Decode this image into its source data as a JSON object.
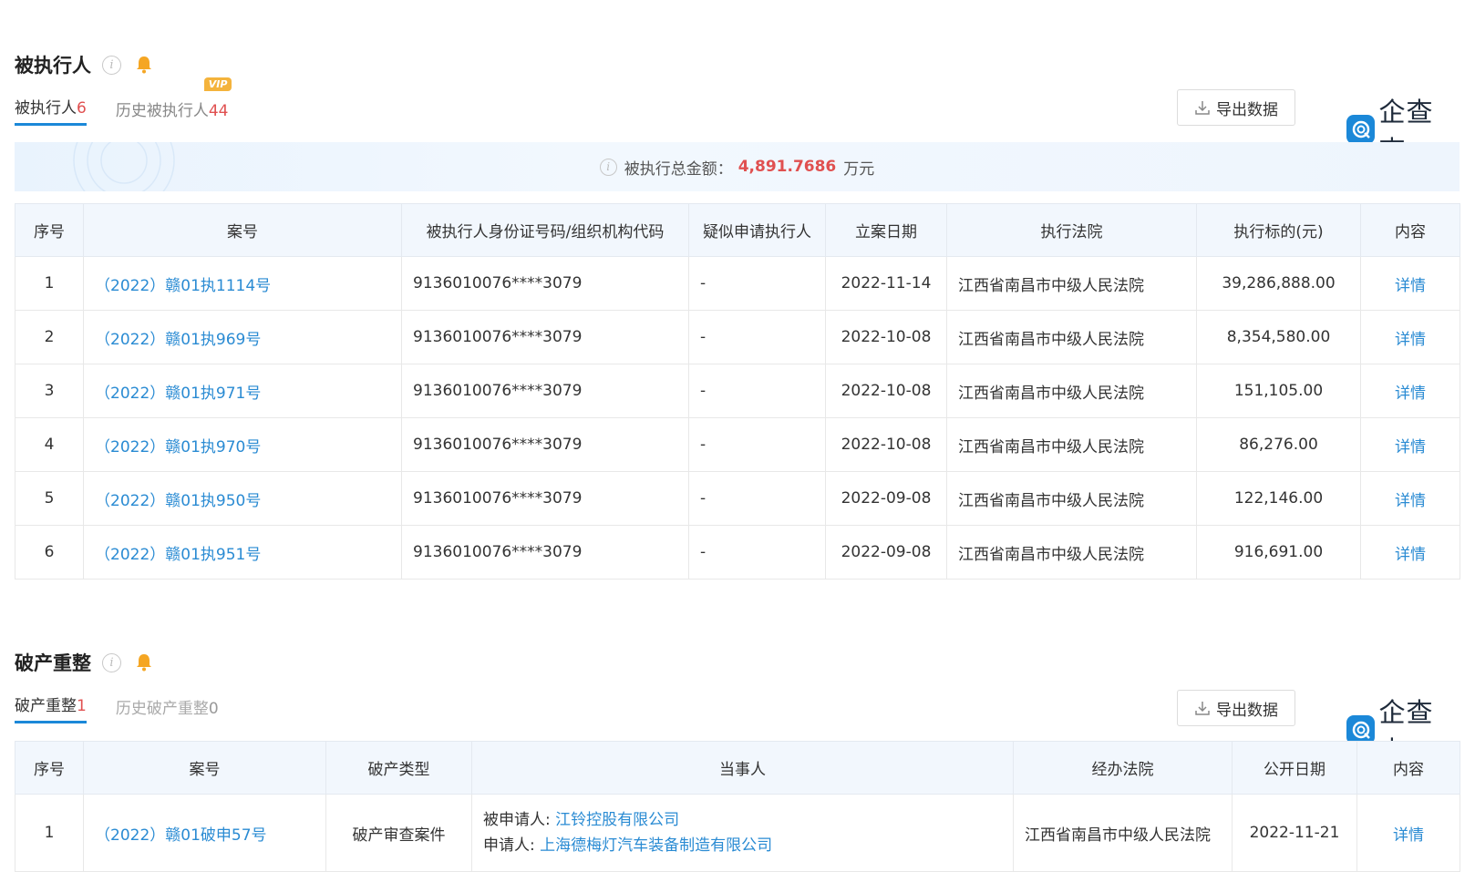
{
  "section1": {
    "title": "被执行人",
    "tabs": [
      {
        "label": "被执行人",
        "count": "6"
      },
      {
        "label": "历史被执行人",
        "count": "44",
        "badge": "VIP"
      }
    ],
    "export_label": "导出数据",
    "brand": "企查查",
    "summary": {
      "label": "被执行总金额：",
      "amount": "4,891.7686",
      "unit": "万元"
    },
    "headers": [
      "序号",
      "案号",
      "被执行人身份证号码/组织机构代码",
      "疑似申请执行人",
      "立案日期",
      "执行法院",
      "执行标的(元)",
      "内容"
    ],
    "rows": [
      {
        "no": "1",
        "case": "（2022）赣01执1114号",
        "id": "9136010076****3079",
        "applicant": "-",
        "date": "2022-11-14",
        "court": "江西省南昌市中级人民法院",
        "amount": "39,286,888.00",
        "action": "详情"
      },
      {
        "no": "2",
        "case": "（2022）赣01执969号",
        "id": "9136010076****3079",
        "applicant": "-",
        "date": "2022-10-08",
        "court": "江西省南昌市中级人民法院",
        "amount": "8,354,580.00",
        "action": "详情"
      },
      {
        "no": "3",
        "case": "（2022）赣01执971号",
        "id": "9136010076****3079",
        "applicant": "-",
        "date": "2022-10-08",
        "court": "江西省南昌市中级人民法院",
        "amount": "151,105.00",
        "action": "详情"
      },
      {
        "no": "4",
        "case": "（2022）赣01执970号",
        "id": "9136010076****3079",
        "applicant": "-",
        "date": "2022-10-08",
        "court": "江西省南昌市中级人民法院",
        "amount": "86,276.00",
        "action": "详情"
      },
      {
        "no": "5",
        "case": "（2022）赣01执950号",
        "id": "9136010076****3079",
        "applicant": "-",
        "date": "2022-09-08",
        "court": "江西省南昌市中级人民法院",
        "amount": "122,146.00",
        "action": "详情"
      },
      {
        "no": "6",
        "case": "（2022）赣01执951号",
        "id": "9136010076****3079",
        "applicant": "-",
        "date": "2022-09-08",
        "court": "江西省南昌市中级人民法院",
        "amount": "916,691.00",
        "action": "详情"
      }
    ]
  },
  "section2": {
    "title": "破产重整",
    "tabs": [
      {
        "label": "破产重整",
        "count": "1"
      },
      {
        "label": "历史破产重整",
        "count": "0"
      }
    ],
    "export_label": "导出数据",
    "brand": "企查查",
    "headers": [
      "序号",
      "案号",
      "破产类型",
      "当事人",
      "经办法院",
      "公开日期",
      "内容"
    ],
    "rows": [
      {
        "no": "1",
        "case": "（2022）赣01破申57号",
        "type": "破产审查案件",
        "respondent_label": "被申请人:",
        "respondent": "江铃控股有限公司",
        "applicant_label": "申请人:",
        "applicant": "上海德梅灯汽车装备制造有限公司",
        "court": "江西省南昌市中级人民法院",
        "date": "2022-11-21",
        "action": "详情"
      }
    ]
  }
}
